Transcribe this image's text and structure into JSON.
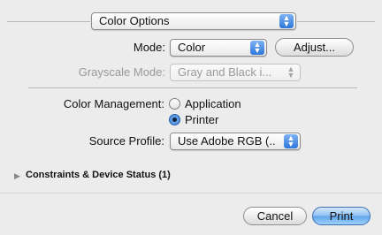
{
  "header": {
    "selected": "Color Options"
  },
  "mode": {
    "label": "Mode:",
    "value": "Color",
    "adjust_button": "Adjust..."
  },
  "grayscale": {
    "label": "Grayscale Mode:",
    "value": "Gray and Black i..."
  },
  "color_management": {
    "label": "Color Management:",
    "options": [
      {
        "label": "Application",
        "selected": false
      },
      {
        "label": "Printer",
        "selected": true
      }
    ]
  },
  "source_profile": {
    "label": "Source Profile:",
    "value": "Use Adobe RGB (..."
  },
  "constraints": {
    "label": "Constraints & Device Status (1)"
  },
  "footer": {
    "cancel": "Cancel",
    "print": "Print"
  },
  "colors": {
    "accent": "#3d85dc",
    "background": "#ececec"
  }
}
